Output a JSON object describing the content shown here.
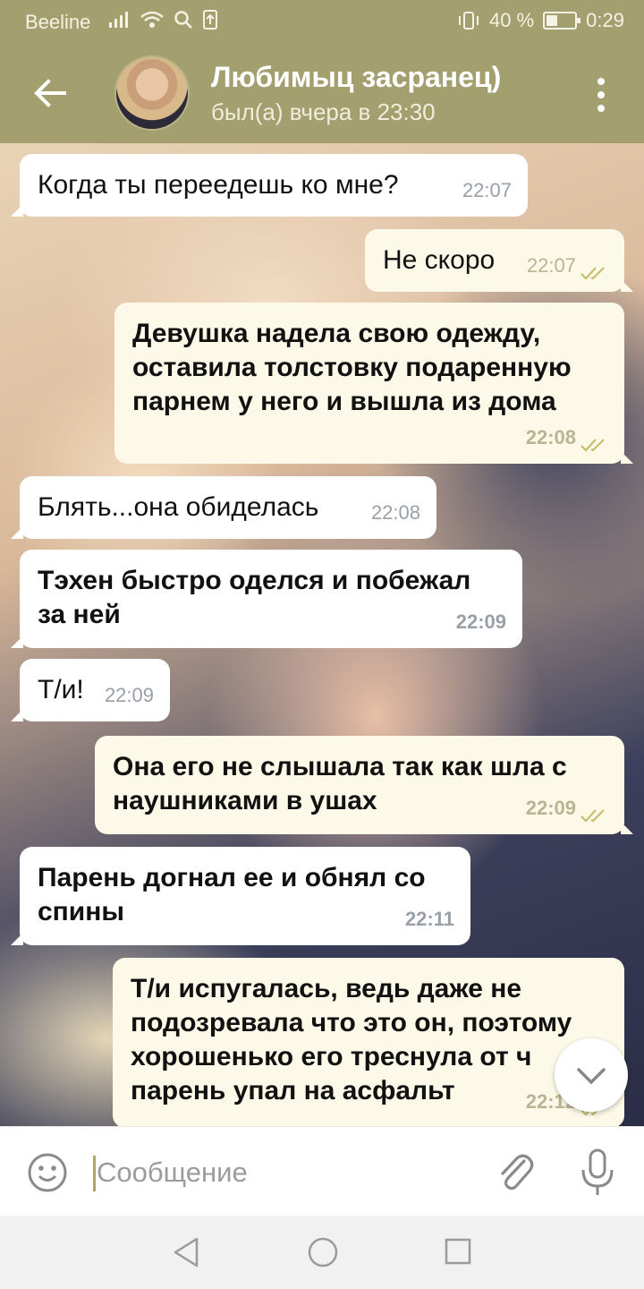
{
  "status_bar": {
    "carrier": "Beeline",
    "battery_text": "40 %",
    "battery_level": 0.4,
    "time": "0:29"
  },
  "header": {
    "title": "Любимыц засранец)",
    "subtitle": "был(а) вчера в 23:30"
  },
  "messages": [
    {
      "side": "in",
      "text": "Когда ты переедешь ко мне?",
      "time": "22:07",
      "bold": false
    },
    {
      "side": "out",
      "text": "Не скоро",
      "time": "22:07",
      "bold": false
    },
    {
      "side": "out",
      "text": "Девушка надела свою одежду, оставила толстовку подаренную парнем у него и вышла из дома",
      "time": "22:08",
      "bold": true
    },
    {
      "side": "in",
      "text": "Блять...она обиделась",
      "time": "22:08",
      "bold": false
    },
    {
      "side": "in",
      "text": "Тэхен быстро оделся и побежал за ней",
      "time": "22:09",
      "bold": true
    },
    {
      "side": "in",
      "text": "Т/и!",
      "time": "22:09",
      "bold": false
    },
    {
      "side": "out",
      "text": "Она его не слышала так как шла с наушниками в ушах",
      "time": "22:09",
      "bold": true
    },
    {
      "side": "in",
      "text": "Парень догнал ее и обнял со спины",
      "time": "22:11",
      "bold": true
    },
    {
      "side": "out",
      "text": "Т/и испугалась, ведь даже не подозревала что это он, поэтому хорошенько его треснула от ч парень упал на асфальт",
      "time": "22:12",
      "bold": true
    }
  ],
  "input": {
    "placeholder": "Сообщение"
  },
  "colors": {
    "header_bg": "#a49f6e",
    "outgoing_bubble": "#fcf9e8",
    "incoming_bubble": "#ffffff",
    "read_ticks": "#c9bd6e"
  },
  "icons": {
    "back": "arrow-left-icon",
    "menu": "more-vertical-icon",
    "emoji": "smiley-icon",
    "attach": "paperclip-icon",
    "mic": "microphone-icon",
    "scroll": "chevron-down-icon"
  }
}
